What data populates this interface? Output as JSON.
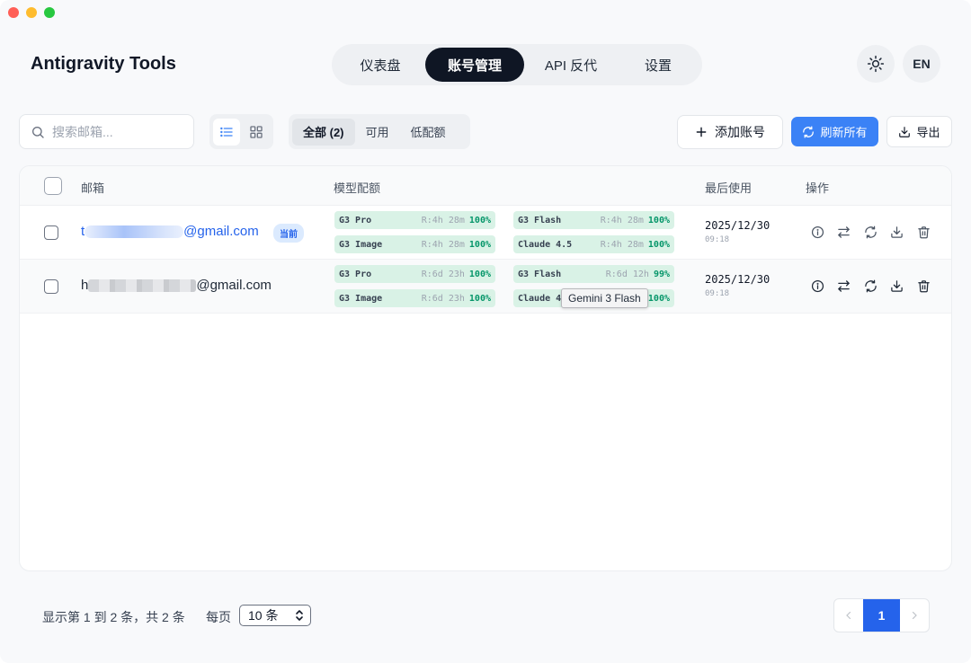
{
  "app": {
    "title": "Antigravity Tools"
  },
  "nav": {
    "items": [
      {
        "label": "仪表盘"
      },
      {
        "label": "账号管理",
        "active": true
      },
      {
        "label": "API 反代"
      },
      {
        "label": "设置"
      }
    ]
  },
  "header_actions": {
    "theme_icon": "sun-icon",
    "language": "EN"
  },
  "toolbar": {
    "search_placeholder": "搜索邮箱...",
    "filters": [
      {
        "label": "全部 (2)",
        "active": true
      },
      {
        "label": "可用"
      },
      {
        "label": "低配额"
      }
    ],
    "add_label": "添加账号",
    "refresh_label": "刷新所有",
    "export_label": "导出"
  },
  "table": {
    "headers": {
      "email": "邮箱",
      "quota": "模型配额",
      "last_used": "最后使用",
      "actions": "操作"
    },
    "rows": [
      {
        "email_prefix": "t",
        "email_suffix": "@gmail.com",
        "current_badge": "当前",
        "quotas": [
          {
            "name": "G3 Pro",
            "reset": "R:4h 28m",
            "pct": "100%"
          },
          {
            "name": "G3 Flash",
            "reset": "R:4h 28m",
            "pct": "100%"
          },
          {
            "name": "G3 Image",
            "reset": "R:4h 28m",
            "pct": "100%"
          },
          {
            "name": "Claude 4.5",
            "reset": "R:4h 28m",
            "pct": "100%"
          }
        ],
        "last_date": "2025/12/30",
        "last_time": "09:18"
      },
      {
        "email_prefix": "h",
        "email_suffix": "@gmail.com",
        "quotas": [
          {
            "name": "G3 Pro",
            "reset": "R:6d 23h",
            "pct": "100%"
          },
          {
            "name": "G3 Flash",
            "reset": "R:6d 12h",
            "pct": "99%"
          },
          {
            "name": "G3 Image",
            "reset": "R:6d 23h",
            "pct": "100%"
          },
          {
            "name": "Claude 4",
            "reset": "",
            "pct": "100%"
          }
        ],
        "last_date": "2025/12/30",
        "last_time": "09:18"
      }
    ],
    "tooltip": "Gemini 3 Flash"
  },
  "footer": {
    "summary": "显示第 1 到 2 条，共 2 条",
    "per_page_label": "每页",
    "per_page_value": "10 条",
    "current_page": "1"
  },
  "colors": {
    "accent": "#3b82f6",
    "nav_active": "#0f1624",
    "quota_bg": "#d9f2e6",
    "quota_pct": "#059669"
  }
}
